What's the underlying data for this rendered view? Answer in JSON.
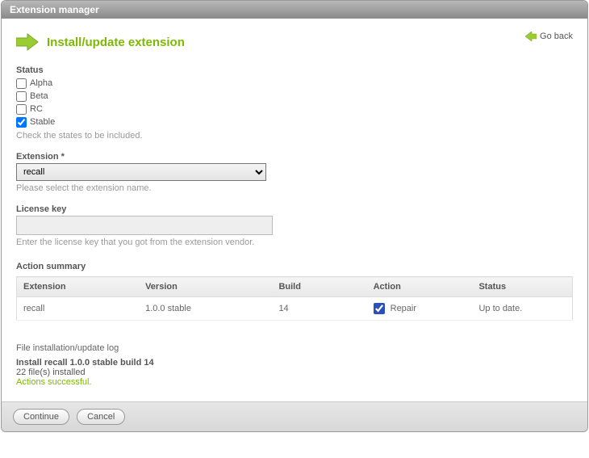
{
  "window": {
    "title": "Extension manager"
  },
  "nav": {
    "go_back": "Go back"
  },
  "heading": "Install/update extension",
  "status": {
    "label": "Status",
    "options": [
      {
        "label": "Alpha",
        "checked": false
      },
      {
        "label": "Beta",
        "checked": false
      },
      {
        "label": "RC",
        "checked": false
      },
      {
        "label": "Stable",
        "checked": true
      }
    ],
    "help": "Check the states to be included."
  },
  "extension": {
    "label": "Extension *",
    "value": "recall",
    "help": "Please select the extension name."
  },
  "license": {
    "label": "License key",
    "value": "",
    "help": "Enter the license key that you got from the extension vendor."
  },
  "summary": {
    "label": "Action summary",
    "headers": {
      "extension": "Extension",
      "version": "Version",
      "build": "Build",
      "action": "Action",
      "status": "Status"
    },
    "rows": [
      {
        "extension": "recall",
        "version": "1.0.0 stable",
        "build": "14",
        "action_label": "Repair",
        "action_checked": true,
        "status": "Up to date."
      }
    ]
  },
  "log": {
    "title": "File installation/update log",
    "main": "Install recall 1.0.0 stable build 14",
    "files": "22 file(s) installed",
    "success": "Actions successful."
  },
  "buttons": {
    "continue": "Continue",
    "cancel": "Cancel"
  }
}
